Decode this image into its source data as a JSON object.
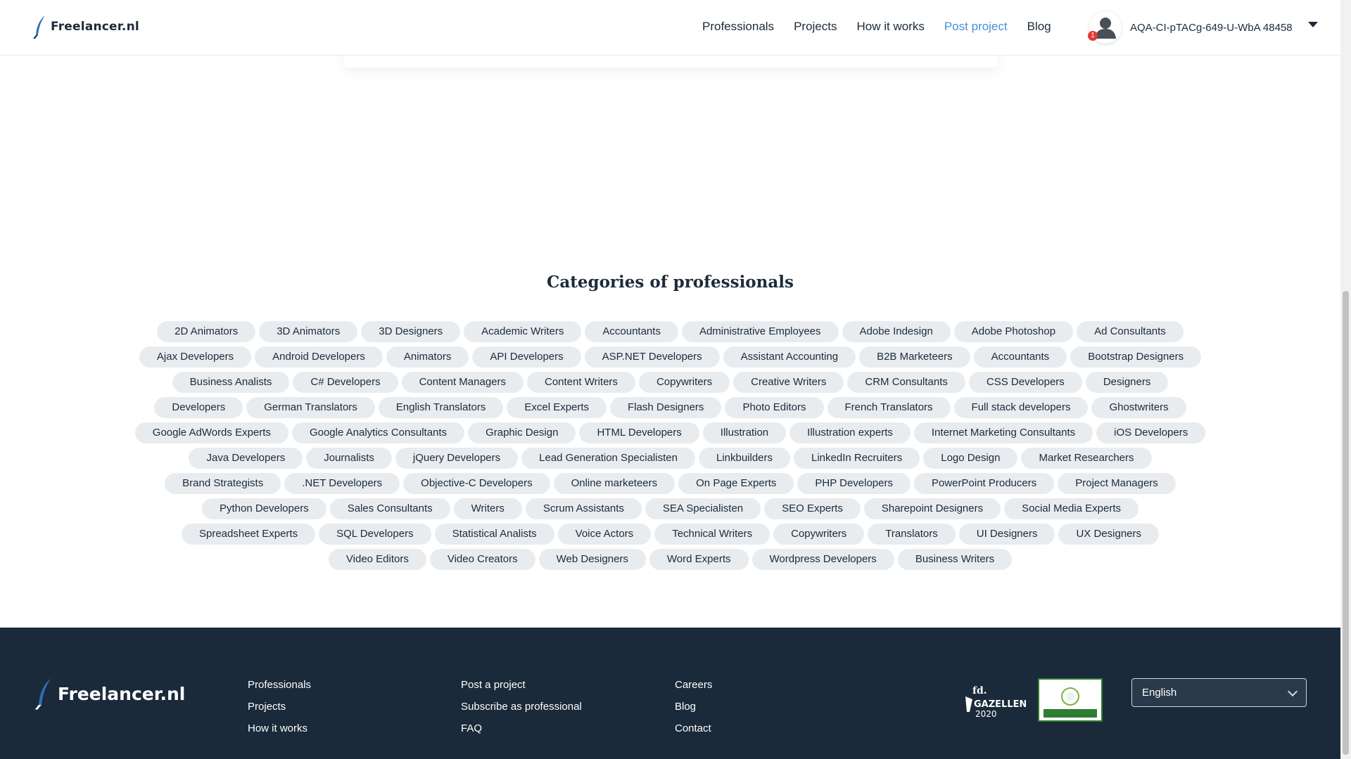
{
  "header": {
    "logo_text": "Freelancer.nl",
    "nav": [
      {
        "label": "Professionals",
        "active": false
      },
      {
        "label": "Projects",
        "active": false
      },
      {
        "label": "How it works",
        "active": false
      },
      {
        "label": "Post project",
        "active": true
      },
      {
        "label": "Blog",
        "active": false
      }
    ],
    "notification_count": "1",
    "username": "AQA-CI-pTACg-649-U-WbA 48458",
    "accent_color": "#4a8fd8"
  },
  "categories": {
    "title": "Categories of professionals",
    "items": [
      "2D Animators",
      "3D Animators",
      "3D Designers",
      "Academic Writers",
      "Accountants",
      "Administrative Employees",
      "Adobe Indesign",
      "Adobe Photoshop",
      "Ad Consultants",
      "Ajax Developers",
      "Android Developers",
      "Animators",
      "API Developers",
      "ASP.NET Developers",
      "Assistant Accounting",
      "B2B Marketeers",
      "Accountants",
      "Bootstrap Designers",
      "Business Analists",
      "C# Developers",
      "Content Managers",
      "Content Writers",
      "Copywriters",
      "Creative Writers",
      "CRM Consultants",
      "CSS Developers",
      "Designers",
      "Developers",
      "German Translators",
      "English Translators",
      "Excel Experts",
      "Flash Designers",
      "Photo Editors",
      "French Translators",
      "Full stack developers",
      "Ghostwriters",
      "Google AdWords Experts",
      "Google Analytics Consultants",
      "Graphic Design",
      "HTML Developers",
      "Illustration",
      "Illustration experts",
      "Internet Marketing Consultants",
      "iOS Developers",
      "Java Developers",
      "Journalists",
      "jQuery Developers",
      "Lead Generation Specialisten",
      "Linkbuilders",
      "LinkedIn Recruiters",
      "Logo Design",
      "Market Researchers",
      "Brand Strategists",
      ".NET Developers",
      "Objective-C Developers",
      "Online marketeers",
      "On Page Experts",
      "PHP Developers",
      "PowerPoint Producers",
      "Project Managers",
      "Python Developers",
      "Sales Consultants",
      "Writers",
      "Scrum Assistants",
      "SEA Specialisten",
      "SEO Experts",
      "Sharepoint Designers",
      "Social Media Experts",
      "Spreadsheet Experts",
      "SQL Developers",
      "Statistical Analists",
      "Voice Actors",
      "Technical Writers",
      "Copywriters",
      "Translators",
      "UI Designers",
      "UX Designers",
      "Video Editors",
      "Video Creators",
      "Web Designers",
      "Word Experts",
      "Wordpress Developers",
      "Business Writers"
    ]
  },
  "footer": {
    "logo_text": "Freelancer.nl",
    "col1": [
      "Professionals",
      "Projects",
      "How it works"
    ],
    "col2": [
      "Post a project",
      "Subscribe as professional",
      "FAQ"
    ],
    "col3": [
      "Careers",
      "Blog",
      "Contact"
    ],
    "award_text": "fd. GAZELLEN 2020",
    "language": "English",
    "background_color": "#1a2a3a"
  }
}
